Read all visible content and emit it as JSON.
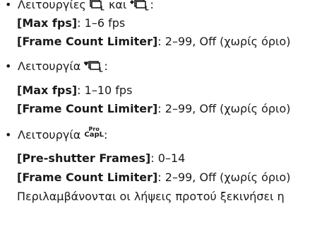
{
  "items": [
    {
      "bullet": "•",
      "mode_prefix": "Λειτουργίες",
      "mode_connector": "και",
      "mode_suffix": ":",
      "icons": [
        "continuous-shooting-low-icon",
        "silent-continuous-shooting-low-icon"
      ],
      "settings": [
        {
          "key": "[Max fps]",
          "value": ": 1–6 fps"
        },
        {
          "key": "[Frame Count Limiter]",
          "value": ": 2–99, Off (χωρίς όριο)"
        }
      ]
    },
    {
      "bullet": "•",
      "mode_prefix": "Λειτουργία",
      "mode_suffix": ":",
      "icons": [
        "heart-continuous-shooting-low-icon"
      ],
      "settings": [
        {
          "key": "[Max fps]",
          "value": ": 1–10 fps"
        },
        {
          "key": "[Frame Count Limiter]",
          "value": ": 2–99, Off (χωρίς όριο)"
        }
      ]
    },
    {
      "bullet": "•",
      "mode_prefix": "Λειτουργία",
      "mode_suffix": ":",
      "icons": [
        "pro-capture-low-icon"
      ],
      "icon_text": {
        "top": "Pro",
        "bottom": "CapL"
      },
      "settings": [
        {
          "key": "[Pre-shutter Frames]",
          "value": ": 0–14"
        },
        {
          "key": "[Frame Count Limiter]",
          "value": ": 2–99, Off (χωρίς όριο)"
        }
      ],
      "note": "Περιλαμβάνονται οι λήψεις προτού ξεκινήσει η"
    }
  ]
}
